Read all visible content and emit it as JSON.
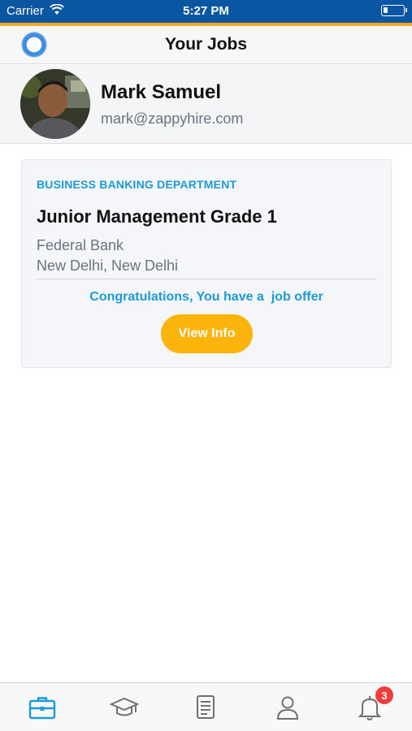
{
  "status_bar": {
    "carrier": "Carrier",
    "time": "5:27 PM",
    "icons": [
      "wifi-icon",
      "battery-icon"
    ]
  },
  "colors": {
    "status_bar": "#0a56a3",
    "accent": "#f5a623",
    "link_blue": "#1c9ad6",
    "button": "#fbb40b",
    "badge": "#f23b3b"
  },
  "header": {
    "title": "Your Jobs",
    "logo_icon": "app-logo-icon"
  },
  "profile": {
    "name": "Mark Samuel",
    "email": "mark@zappyhire.com"
  },
  "job": {
    "department": "BUSINESS BANKING DEPARTMENT",
    "title": "Junior Management Grade 1",
    "company": "Federal Bank",
    "location": "New Delhi, New Delhi",
    "status_message": "Congratulations, You have a  job offer",
    "action_label": "View Info"
  },
  "tabs": [
    {
      "icon": "briefcase-icon",
      "active": true
    },
    {
      "icon": "graduation-cap-icon",
      "active": false
    },
    {
      "icon": "document-icon",
      "active": false
    },
    {
      "icon": "user-icon",
      "active": false
    },
    {
      "icon": "bell-icon",
      "active": false,
      "badge": "3"
    }
  ]
}
